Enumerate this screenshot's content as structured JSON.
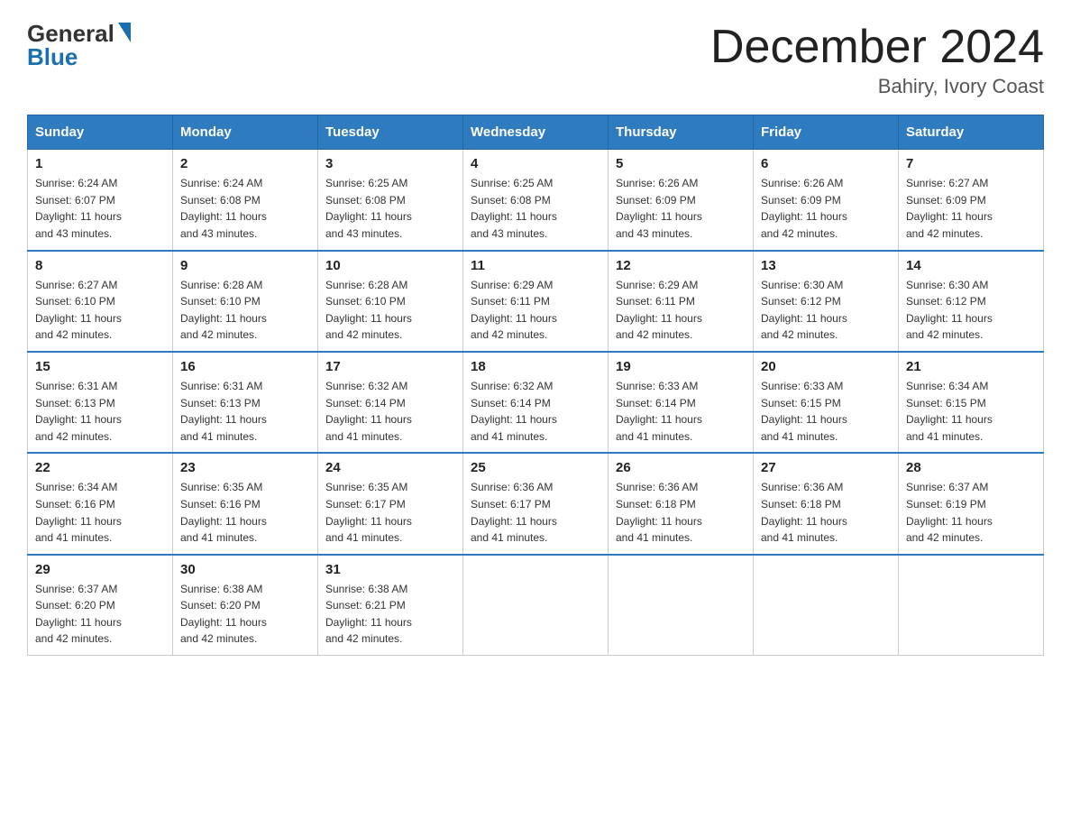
{
  "logo": {
    "general": "General",
    "blue": "Blue"
  },
  "title": {
    "month_year": "December 2024",
    "location": "Bahiry, Ivory Coast"
  },
  "headers": [
    "Sunday",
    "Monday",
    "Tuesday",
    "Wednesday",
    "Thursday",
    "Friday",
    "Saturday"
  ],
  "weeks": [
    [
      {
        "day": "1",
        "sunrise": "6:24 AM",
        "sunset": "6:07 PM",
        "daylight": "11 hours and 43 minutes."
      },
      {
        "day": "2",
        "sunrise": "6:24 AM",
        "sunset": "6:08 PM",
        "daylight": "11 hours and 43 minutes."
      },
      {
        "day": "3",
        "sunrise": "6:25 AM",
        "sunset": "6:08 PM",
        "daylight": "11 hours and 43 minutes."
      },
      {
        "day": "4",
        "sunrise": "6:25 AM",
        "sunset": "6:08 PM",
        "daylight": "11 hours and 43 minutes."
      },
      {
        "day": "5",
        "sunrise": "6:26 AM",
        "sunset": "6:09 PM",
        "daylight": "11 hours and 43 minutes."
      },
      {
        "day": "6",
        "sunrise": "6:26 AM",
        "sunset": "6:09 PM",
        "daylight": "11 hours and 42 minutes."
      },
      {
        "day": "7",
        "sunrise": "6:27 AM",
        "sunset": "6:09 PM",
        "daylight": "11 hours and 42 minutes."
      }
    ],
    [
      {
        "day": "8",
        "sunrise": "6:27 AM",
        "sunset": "6:10 PM",
        "daylight": "11 hours and 42 minutes."
      },
      {
        "day": "9",
        "sunrise": "6:28 AM",
        "sunset": "6:10 PM",
        "daylight": "11 hours and 42 minutes."
      },
      {
        "day": "10",
        "sunrise": "6:28 AM",
        "sunset": "6:10 PM",
        "daylight": "11 hours and 42 minutes."
      },
      {
        "day": "11",
        "sunrise": "6:29 AM",
        "sunset": "6:11 PM",
        "daylight": "11 hours and 42 minutes."
      },
      {
        "day": "12",
        "sunrise": "6:29 AM",
        "sunset": "6:11 PM",
        "daylight": "11 hours and 42 minutes."
      },
      {
        "day": "13",
        "sunrise": "6:30 AM",
        "sunset": "6:12 PM",
        "daylight": "11 hours and 42 minutes."
      },
      {
        "day": "14",
        "sunrise": "6:30 AM",
        "sunset": "6:12 PM",
        "daylight": "11 hours and 42 minutes."
      }
    ],
    [
      {
        "day": "15",
        "sunrise": "6:31 AM",
        "sunset": "6:13 PM",
        "daylight": "11 hours and 42 minutes."
      },
      {
        "day": "16",
        "sunrise": "6:31 AM",
        "sunset": "6:13 PM",
        "daylight": "11 hours and 41 minutes."
      },
      {
        "day": "17",
        "sunrise": "6:32 AM",
        "sunset": "6:14 PM",
        "daylight": "11 hours and 41 minutes."
      },
      {
        "day": "18",
        "sunrise": "6:32 AM",
        "sunset": "6:14 PM",
        "daylight": "11 hours and 41 minutes."
      },
      {
        "day": "19",
        "sunrise": "6:33 AM",
        "sunset": "6:14 PM",
        "daylight": "11 hours and 41 minutes."
      },
      {
        "day": "20",
        "sunrise": "6:33 AM",
        "sunset": "6:15 PM",
        "daylight": "11 hours and 41 minutes."
      },
      {
        "day": "21",
        "sunrise": "6:34 AM",
        "sunset": "6:15 PM",
        "daylight": "11 hours and 41 minutes."
      }
    ],
    [
      {
        "day": "22",
        "sunrise": "6:34 AM",
        "sunset": "6:16 PM",
        "daylight": "11 hours and 41 minutes."
      },
      {
        "day": "23",
        "sunrise": "6:35 AM",
        "sunset": "6:16 PM",
        "daylight": "11 hours and 41 minutes."
      },
      {
        "day": "24",
        "sunrise": "6:35 AM",
        "sunset": "6:17 PM",
        "daylight": "11 hours and 41 minutes."
      },
      {
        "day": "25",
        "sunrise": "6:36 AM",
        "sunset": "6:17 PM",
        "daylight": "11 hours and 41 minutes."
      },
      {
        "day": "26",
        "sunrise": "6:36 AM",
        "sunset": "6:18 PM",
        "daylight": "11 hours and 41 minutes."
      },
      {
        "day": "27",
        "sunrise": "6:36 AM",
        "sunset": "6:18 PM",
        "daylight": "11 hours and 41 minutes."
      },
      {
        "day": "28",
        "sunrise": "6:37 AM",
        "sunset": "6:19 PM",
        "daylight": "11 hours and 42 minutes."
      }
    ],
    [
      {
        "day": "29",
        "sunrise": "6:37 AM",
        "sunset": "6:20 PM",
        "daylight": "11 hours and 42 minutes."
      },
      {
        "day": "30",
        "sunrise": "6:38 AM",
        "sunset": "6:20 PM",
        "daylight": "11 hours and 42 minutes."
      },
      {
        "day": "31",
        "sunrise": "6:38 AM",
        "sunset": "6:21 PM",
        "daylight": "11 hours and 42 minutes."
      },
      null,
      null,
      null,
      null
    ]
  ],
  "labels": {
    "sunrise": "Sunrise:",
    "sunset": "Sunset:",
    "daylight": "Daylight:"
  }
}
